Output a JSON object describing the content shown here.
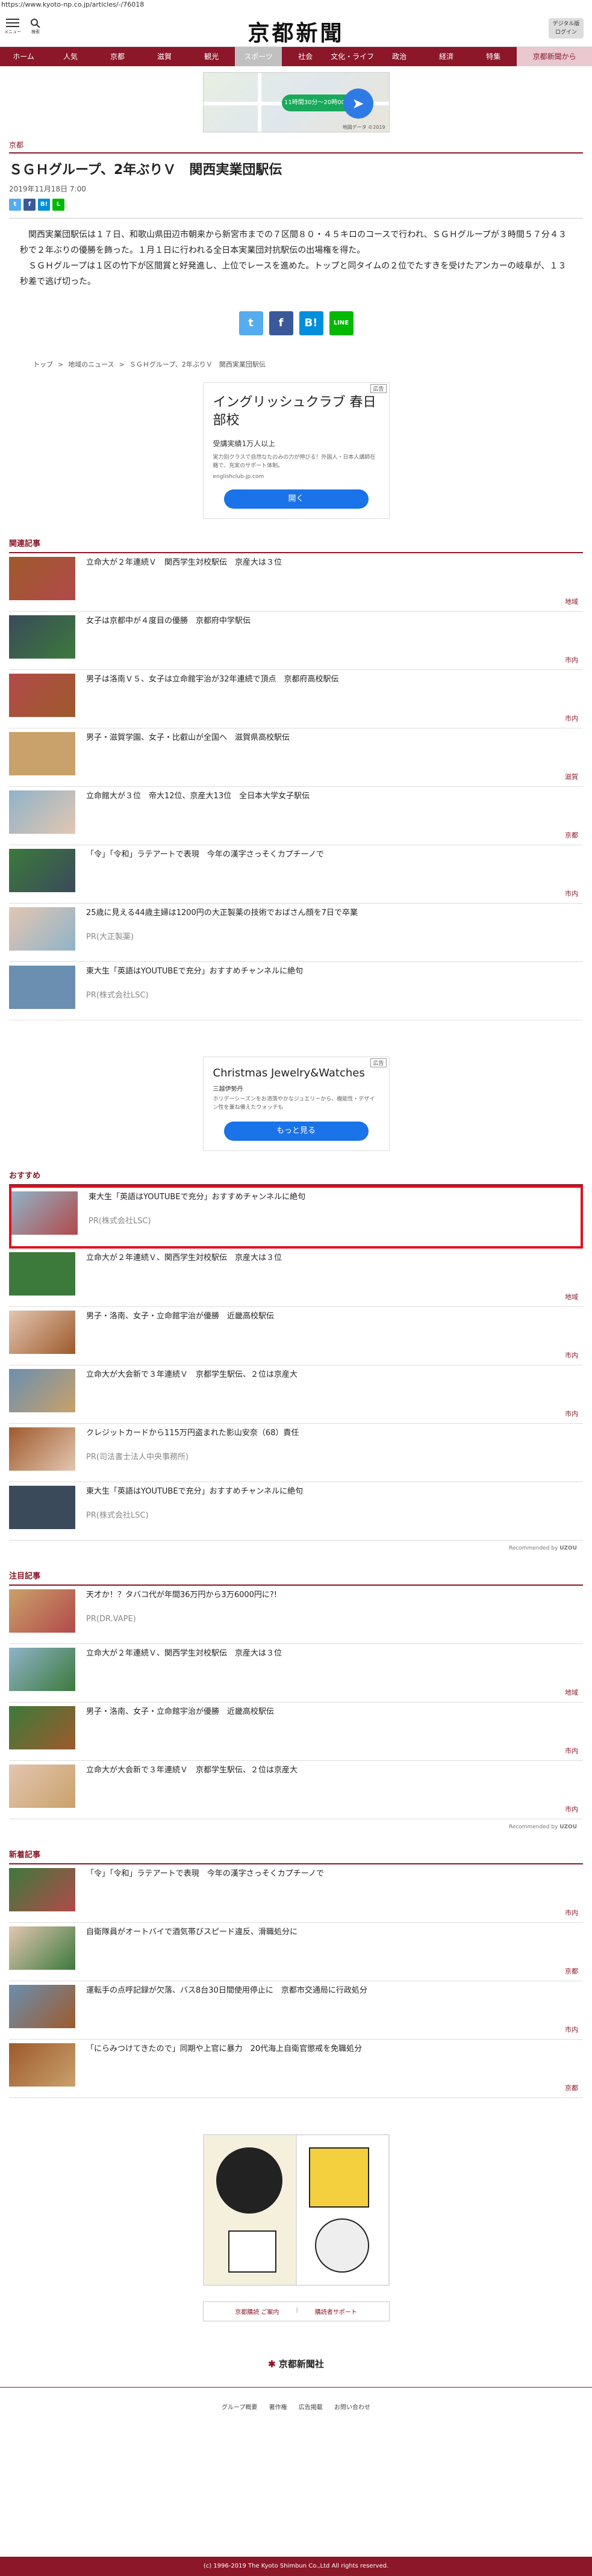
{
  "url": "https://www.kyoto-np.co.jp/articles/-/76018",
  "header": {
    "menu_label": "メニュー",
    "search_label": "検索",
    "logo": "京都新聞",
    "digital_label_1": "デジタル版",
    "digital_label_2": "ログイン"
  },
  "nav": [
    "ホーム",
    "人気",
    "京都",
    "滋賀",
    "観光",
    "スポーツ",
    "社会",
    "文化・ライフ",
    "政治",
    "経済",
    "特集",
    "京都新聞から"
  ],
  "nav_active_index": 5,
  "top_ad": {
    "pill": "11時間30分〜20時00分",
    "map_credit": "地図データ ©2019"
  },
  "article": {
    "category": "京都",
    "title": "ＳＧＨグループ、2年ぶりＶ　関西実業団駅伝",
    "date": "2019年11月18日 7:00",
    "paragraphs": [
      "関西実業団駅伝は１７日、和歌山県田辺市朝来から新宮市までの７区間８０・４５キロのコースで行われ、ＳＧＨグループが３時間５７分４３秒で２年ぶりの優勝を飾った。１月１日に行われる全日本実業団対抗駅伝の出場権を得た。",
      "ＳＧＨグループは１区の竹下が区間賞と好発進し、上位でレースを進めた。トップと同タイムの２位でたすきを受けたアンカーの岐阜が、１３秒差で逃げ切った。"
    ]
  },
  "share_small": [
    "t",
    "f",
    "B!",
    "L"
  ],
  "share_big": [
    "t",
    "f",
    "B!",
    "LINE"
  ],
  "breadcrumb": [
    "トップ",
    ">",
    "地域のニュース",
    ">",
    "ＳＧＨグループ、2年ぶりＶ　関西実業団駅伝"
  ],
  "ad_box_1": {
    "tag": "広告",
    "title": "イングリッシュクラブ 春日部校",
    "sub": "受講実績1万人以上",
    "desc": "実力別クラスで自然なたのみの力が伸びる！外国人・日本人講師在籍で、充実のサポート体制。",
    "site": "englishclub-jp.com",
    "button": "開く"
  },
  "related": {
    "heading": "関連記事",
    "items": [
      {
        "text": "立命大が２年連続Ｖ　関西学生対校駅伝　京産大は３位",
        "tag": "地域"
      },
      {
        "text": "女子は京都中が４度目の優勝　京都府中学駅伝",
        "tag": "市内"
      },
      {
        "text": "男子は洛南Ｖ５、女子は立命館宇治が32年連続で頂点　京都府高校駅伝",
        "tag": "市内"
      },
      {
        "text": "男子・滋賀学園、女子・比叡山が全国へ　滋賀県高校駅伝",
        "tag": "滋賀"
      },
      {
        "text": "立命館大が３位　帝大12位、京産大13位　全日本大学女子駅伝",
        "tag": "京都"
      },
      {
        "text": "「令」「令和」ラテアートで表現　今年の漢字さっそくカプチーノで",
        "tag": "市内"
      },
      {
        "text": "25歳に見える44歳主婦は1200円の大正製薬の技術でおばさん顔を7日で卒業",
        "pr": "PR(大正製薬)"
      },
      {
        "text": "東大生「英語はYOUTUBEで充分」おすすめチャンネルに絶句",
        "pr": "PR(株式会社LSC)"
      }
    ]
  },
  "ad_box_2": {
    "tag": "広告",
    "title": "Christmas Jewelry&Watches",
    "sub": "三越伊勢丹",
    "desc": "ホリデーシーズンをお洒落やかなジュエリーから、機能性・デザイン性を兼ね備えたウォッチも",
    "button": "もっと見る"
  },
  "recommended": {
    "heading": "おすすめ",
    "items": [
      {
        "text": "東大生「英語はYOUTUBEで充分」おすすめチャンネルに絶句",
        "pr": "PR(株式会社LSC)"
      },
      {
        "text": "立命大が２年連続Ｖ、関西学生対校駅伝　京産大は３位",
        "tag": "地域"
      },
      {
        "text": "男子・洛南、女子・立命館宇治が優勝　近畿高校駅伝",
        "tag": "市内"
      },
      {
        "text": "立命大が大会新で３年連続Ｖ　京都学生駅伝、２位は京産大",
        "tag": "市内"
      },
      {
        "text": "クレジットカードから115万円盗まれた影山安奈（68）責任",
        "pr": "PR(司法書士法人中央事務所)"
      },
      {
        "text": "東大生「英語はYOUTUBEで充分」おすすめチャンネルに絶句",
        "pr": "PR(株式会社LSC)"
      }
    ],
    "note": "Recommended by"
  },
  "featured": {
    "heading": "注目記事",
    "items": [
      {
        "text": "天才か！？タバコ代が年間36万円から3万6000円に?!",
        "pr": "PR(DR.VAPE)"
      },
      {
        "text": "立命大が２年連続Ｖ、関西学生対校駅伝　京産大は３位",
        "tag": "地域"
      },
      {
        "text": "男子・洛南、女子・立命館宇治が優勝　近畿高校駅伝",
        "tag": "市内"
      },
      {
        "text": "立命大が大会新で３年連続Ｖ　京都学生駅伝、２位は京産大",
        "tag": "市内"
      }
    ],
    "note": "Recommended by"
  },
  "latest": {
    "heading": "新着記事",
    "items": [
      {
        "text": "「令」「令和」ラテアートで表現　今年の漢字さっそくカプチーノで",
        "tag": "市内"
      },
      {
        "text": "自衛隊員がオートバイで酒気帯びスピード違反、滑職処分に",
        "tag": "京都"
      },
      {
        "text": "運転手の点呼記録が欠落、バス8台30日間使用停止に　京都市交通局に行政処分",
        "tag": "市内"
      },
      {
        "text": "「にらみつけてきたので」同期や上官に暴力　20代海上自衛官懲戒を免職処分",
        "tag": "京都"
      }
    ]
  },
  "footer": {
    "btn1": "京都購読 ご案内",
    "btn2": "購読者サポート",
    "logo": "京都新聞社",
    "links": [
      "グループ概要",
      "著作権",
      "広告掲載",
      "お問い合わせ"
    ],
    "copyright": "(c) 1996-2019 The Kyoto Shimbun Co.,Ltd All rights reserved."
  },
  "colors": {
    "brand": "#8b1728",
    "highlight": "#e0101e"
  }
}
